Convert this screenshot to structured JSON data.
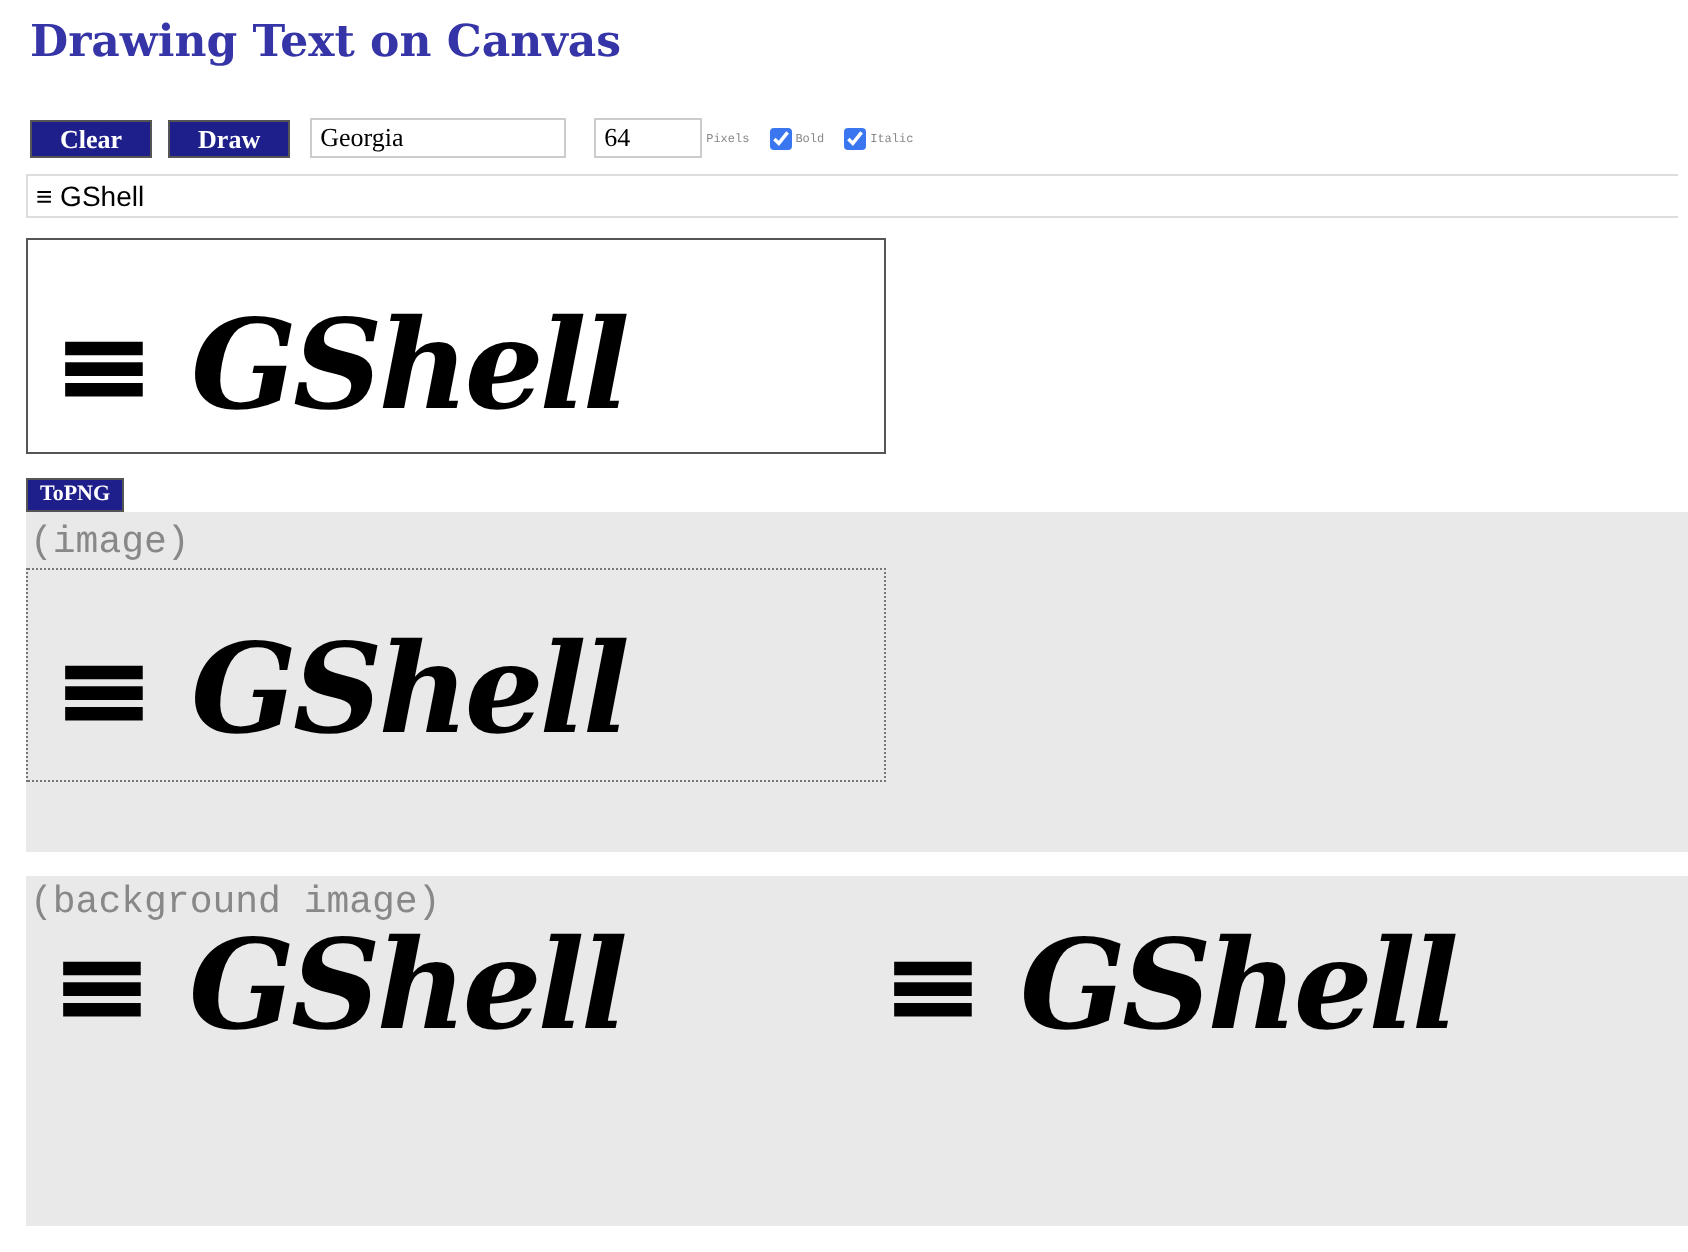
{
  "title": "Drawing Text on Canvas",
  "toolbar": {
    "clear_button": "Clear",
    "draw_button": "Draw",
    "font_field": {
      "value": "Georgia"
    },
    "size_field": {
      "value": "64"
    },
    "size_unit": "Pixels",
    "options": [
      {
        "label": "Bold",
        "checked": true
      },
      {
        "label": "Italic",
        "checked": true
      }
    ]
  },
  "text_field": {
    "value": "≡ GShell"
  },
  "canvas": {
    "text": "≡ GShell"
  },
  "topng_button": "ToPNG",
  "image_section": {
    "label": "(image)",
    "text": "≡ GShell"
  },
  "background_section": {
    "label": "(background image)",
    "tiles": [
      "≡ GShell",
      "≡ GShell"
    ]
  }
}
